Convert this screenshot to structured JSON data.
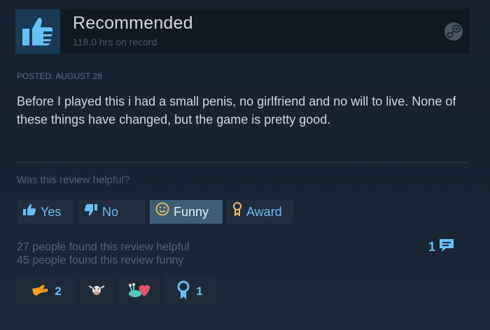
{
  "review": {
    "verdict": "Recommended",
    "hours": "118.0 hrs on record",
    "posted": "POSTED: AUGUST 28",
    "text": "Before I played this i had a small penis, no girlfriend and no will to live. None of these things have changed, but the game is pretty good."
  },
  "helpful": {
    "question": "Was this review helpful?",
    "yes_label": "Yes",
    "no_label": "No",
    "funny_label": "Funny",
    "award_label": "Award"
  },
  "stats": {
    "helpful_count_text": "27 people found this review helpful",
    "funny_count_text": "45 people found this review funny",
    "comment_count": "1"
  },
  "reactions": [
    {
      "icon": "thumbs-hand-icon",
      "count": "2"
    },
    {
      "icon": "cow-icon",
      "count": ""
    },
    {
      "icon": "slug-heart-icon",
      "count": ""
    },
    {
      "icon": "award-ribbon-icon",
      "count": "1"
    }
  ],
  "colors": {
    "background": "#1b2838",
    "accent_blue": "#67c1f5",
    "funny_active": "#3d5d77",
    "thumb_up": "#66c0f4"
  }
}
